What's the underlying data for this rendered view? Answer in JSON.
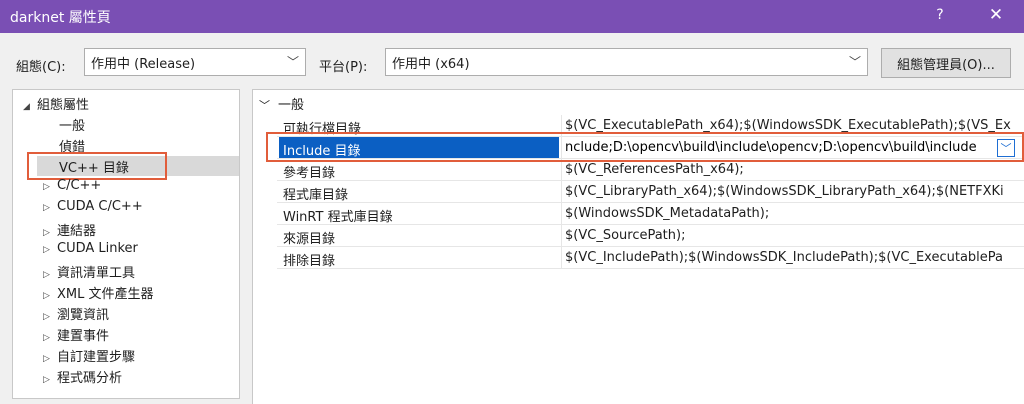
{
  "window": {
    "title": "darknet 屬性頁",
    "help": "?",
    "close": "✕"
  },
  "config": {
    "config_label": "組態(C):",
    "config_value": "作用中 (Release)",
    "platform_label": "平台(P):",
    "platform_value": "作用中 (x64)",
    "manager_button": "組態管理員(O)..."
  },
  "tree": {
    "items": [
      {
        "label": "組態屬性",
        "arrow": "◢"
      },
      {
        "label": "一般",
        "arrow": ""
      },
      {
        "label": "偵錯",
        "arrow": ""
      },
      {
        "label": "VC++ 目錄",
        "arrow": ""
      },
      {
        "label": "C/C++",
        "arrow": "▷"
      },
      {
        "label": "CUDA C/C++",
        "arrow": "▷"
      },
      {
        "label": "連結器",
        "arrow": "▷"
      },
      {
        "label": "CUDA Linker",
        "arrow": "▷"
      },
      {
        "label": "資訊清單工具",
        "arrow": "▷"
      },
      {
        "label": "XML 文件產生器",
        "arrow": "▷"
      },
      {
        "label": "瀏覽資訊",
        "arrow": "▷"
      },
      {
        "label": "建置事件",
        "arrow": "▷"
      },
      {
        "label": "自訂建置步驟",
        "arrow": "▷"
      },
      {
        "label": "程式碼分析",
        "arrow": "▷"
      }
    ]
  },
  "grid": {
    "section": "一般",
    "rows": [
      {
        "name": "可執行檔目錄",
        "value": "$(VC_ExecutablePath_x64);$(WindowsSDK_ExecutablePath);$(VS_Ex"
      },
      {
        "name": "Include 目錄",
        "value": "nclude;D:\\opencv\\build\\include\\opencv;D:\\opencv\\build\\include"
      },
      {
        "name": "參考目錄",
        "value": "$(VC_ReferencesPath_x64);"
      },
      {
        "name": "程式庫目錄",
        "value": "$(VC_LibraryPath_x64);$(WindowsSDK_LibraryPath_x64);$(NETFXKi"
      },
      {
        "name": "WinRT 程式庫目錄",
        "value": "$(WindowsSDK_MetadataPath);"
      },
      {
        "name": "來源目錄",
        "value": "$(VC_SourcePath);"
      },
      {
        "name": "排除目錄",
        "value": "$(VC_IncludePath);$(WindowsSDK_IncludePath);$(VC_ExecutablePa"
      }
    ]
  },
  "colors": {
    "titlebar": "#7a4fb4",
    "selection": "#0b5fc3",
    "highlight_box": "#e15d3b"
  }
}
